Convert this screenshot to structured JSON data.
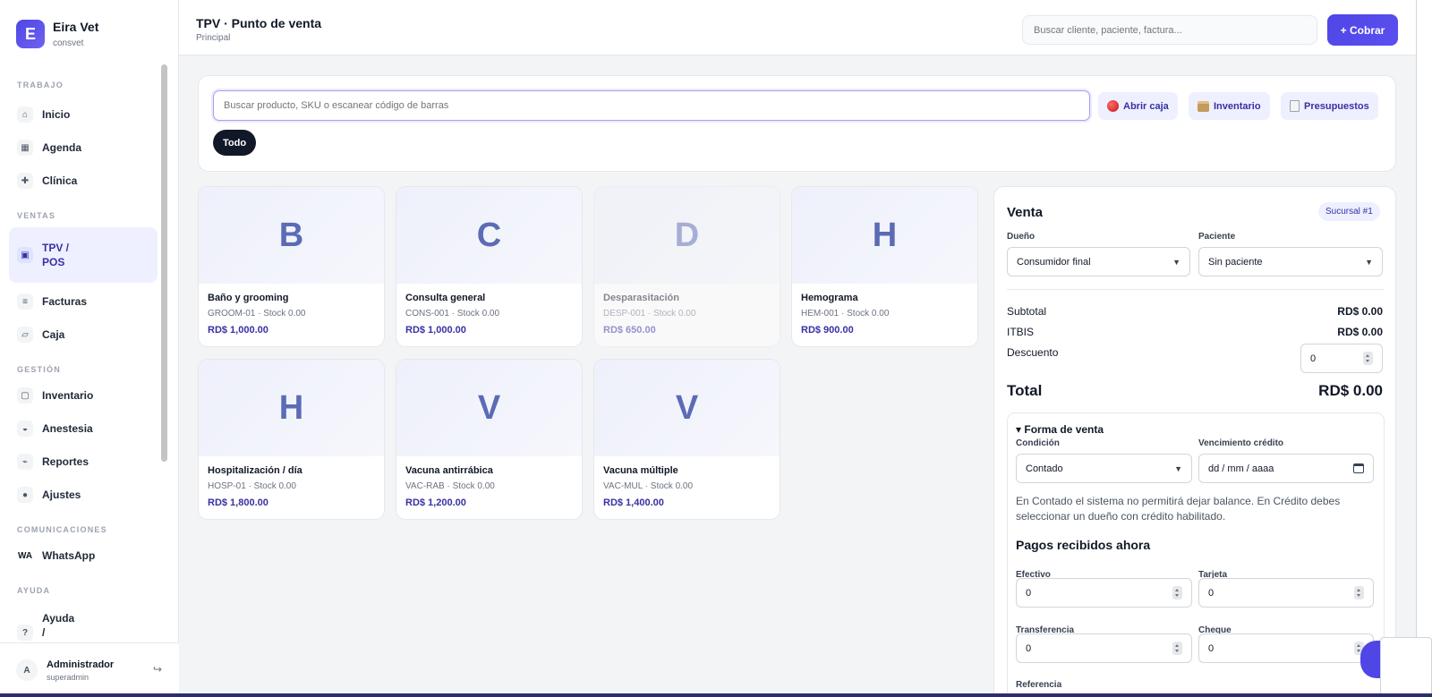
{
  "brand": {
    "logo_letter": "E",
    "name": "Eira Vet",
    "subtitle": "consvet"
  },
  "nav": {
    "sections": [
      {
        "title": "TRABAJO",
        "items": [
          {
            "id": "inicio",
            "label": "Inicio",
            "icon": "⌂",
            "icon_name": "home-icon"
          },
          {
            "id": "agenda",
            "label": "Agenda",
            "icon": "▦",
            "icon_name": "calendar-icon"
          },
          {
            "id": "clinica",
            "label": "Clínica",
            "icon": "✚",
            "icon_name": "medical-cross-icon"
          }
        ]
      },
      {
        "title": "VENTAS",
        "items": [
          {
            "id": "tpv",
            "label": "TPV / POS",
            "icon": "▣",
            "icon_name": "pos-terminal-icon",
            "active": true
          },
          {
            "id": "facturas",
            "label": "Facturas",
            "icon": "≡",
            "icon_name": "invoice-icon"
          },
          {
            "id": "caja",
            "label": "Caja",
            "icon": "▱",
            "icon_name": "cash-register-icon"
          }
        ]
      },
      {
        "title": "GESTIÓN",
        "items": [
          {
            "id": "inventario",
            "label": "Inventario",
            "icon": "▢",
            "icon_name": "inventory-icon"
          },
          {
            "id": "anestesia",
            "label": "Anestesia",
            "icon": "◒",
            "icon_name": "anesthesia-icon"
          },
          {
            "id": "reportes",
            "label": "Reportes",
            "icon": "⌁",
            "icon_name": "reports-icon"
          },
          {
            "id": "ajustes",
            "label": "Ajustes",
            "icon": "●",
            "icon_name": "settings-icon"
          }
        ]
      },
      {
        "title": "COMUNICACIONES",
        "items": [
          {
            "id": "whatsapp",
            "label": "WhatsApp",
            "icon": "WA",
            "icon_name": "whatsapp-icon"
          }
        ]
      },
      {
        "title": "AYUDA",
        "items": [
          {
            "id": "ayuda",
            "label": "Ayuda / Manual",
            "icon": "?",
            "icon_name": "help-icon"
          }
        ]
      }
    ]
  },
  "user": {
    "initial": "A",
    "name": "Administrador",
    "role": "superadmin"
  },
  "header": {
    "title": "TPV · Punto de venta",
    "breadcrumb": "Principal",
    "search_placeholder": "Buscar cliente, paciente, factura...",
    "cobrar_label": "+ Cobrar"
  },
  "toolbar": {
    "search_placeholder": "Buscar producto, SKU o escanear código de barras",
    "buttons": [
      {
        "id": "abrir-caja",
        "label": "Abrir caja",
        "icon_name": "red-circle-icon"
      },
      {
        "id": "inventario",
        "label": "Inventario",
        "icon_name": "package-icon"
      },
      {
        "id": "presupuestos",
        "label": "Presupuestos",
        "icon_name": "document-icon"
      }
    ],
    "filter_chip": "Todo"
  },
  "products": [
    {
      "letter": "B",
      "name": "Baño y grooming",
      "meta": "GROOM-01 · Stock 0.00",
      "price": "RD$ 1,000.00"
    },
    {
      "letter": "C",
      "name": "Consulta general",
      "meta": "CONS-001 · Stock 0.00",
      "price": "RD$ 1,000.00"
    },
    {
      "letter": "D",
      "name": "Desparasitación",
      "meta": "DESP-001 · Stock 0.00",
      "price": "RD$ 650.00",
      "disabled": true
    },
    {
      "letter": "H",
      "name": "Hemograma",
      "meta": "HEM-001 · Stock 0.00",
      "price": "RD$ 900.00"
    },
    {
      "letter": "H",
      "name": "Hospitalización / día",
      "meta": "HOSP-01 · Stock 0.00",
      "price": "RD$ 1,800.00"
    },
    {
      "letter": "V",
      "name": "Vacuna antirrábica",
      "meta": "VAC-RAB · Stock 0.00",
      "price": "RD$ 1,200.00"
    },
    {
      "letter": "V",
      "name": "Vacuna múltiple",
      "meta": "VAC-MUL · Stock 0.00",
      "price": "RD$ 1,400.00"
    }
  ],
  "sale": {
    "title": "Venta",
    "branch_badge": "Sucursal #1",
    "owner_label": "Dueño",
    "owner_value": "Consumidor final",
    "patient_label": "Paciente",
    "patient_value": "Sin paciente",
    "subtotal_label": "Subtotal",
    "subtotal_value": "RD$ 0.00",
    "itbis_label": "ITBIS",
    "itbis_value": "RD$ 0.00",
    "discount_label": "Descuento",
    "discount_value": "0",
    "total_label": "Total",
    "total_value": "RD$ 0.00",
    "forma_title": "▾ Forma de venta",
    "condicion_label": "Condición",
    "condicion_value": "Contado",
    "vencimiento_label": "Vencimiento crédito",
    "vencimiento_placeholder": "dd / mm / aaaa",
    "info_text": "En Contado el sistema no permitirá dejar balance. En Crédito debes seleccionar un dueño con crédito habilitado.",
    "pagos_title": "Pagos recibidos ahora",
    "efectivo_label": "Efectivo",
    "efectivo_value": "0",
    "tarjeta_label": "Tarjeta",
    "tarjeta_value": "0",
    "transferencia_label": "Transferencia",
    "transferencia_value": "0",
    "cheque_label": "Cheque",
    "cheque_value": "0",
    "referencia_label": "Referencia"
  },
  "colors": {
    "accent": "#4f46e5",
    "accent_soft": "#eef0ff",
    "accent_text": "#3730a3",
    "chip_dark": "#111827"
  }
}
